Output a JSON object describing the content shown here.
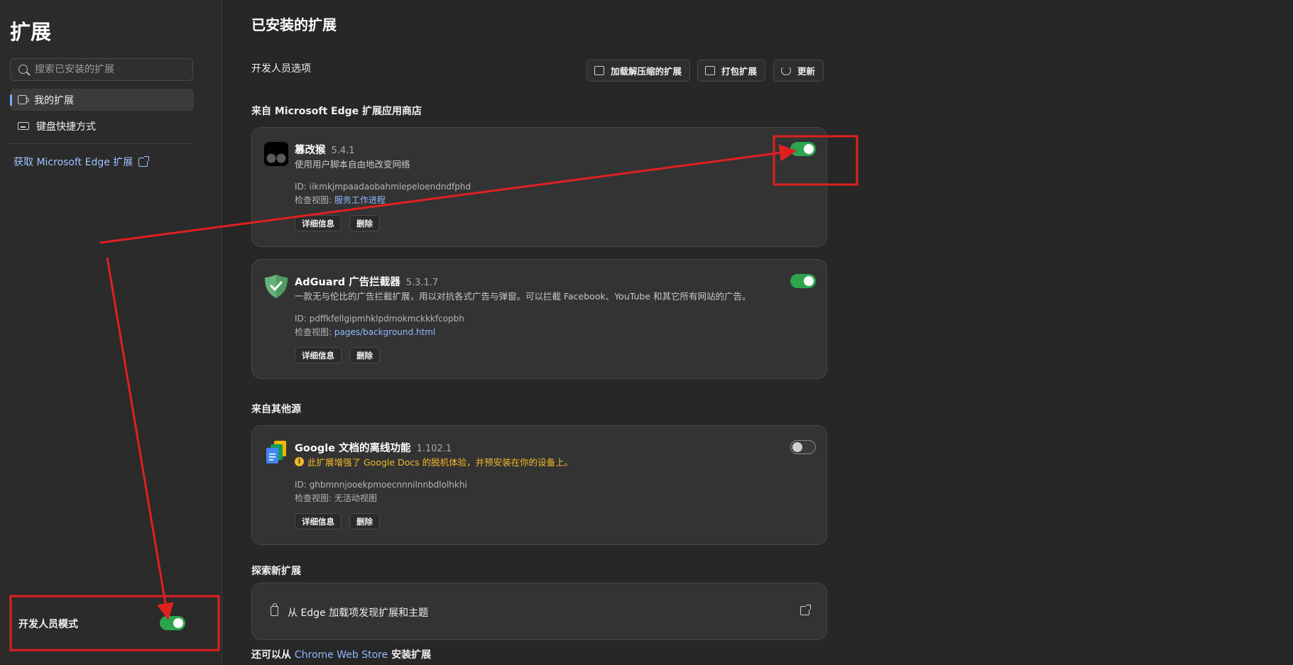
{
  "sidebar": {
    "title": "扩展",
    "search_placeholder": "搜索已安装的扩展",
    "nav": [
      {
        "label": "我的扩展",
        "icon": "puzzle-icon",
        "active": true
      },
      {
        "label": "键盘快捷方式",
        "icon": "keyboard-icon",
        "active": false
      }
    ],
    "get_extensions_label": "获取 Microsoft Edge 扩展",
    "developer_mode_label": "开发人员模式",
    "developer_mode_on": true
  },
  "main": {
    "title": "已安装的扩展",
    "developer_options_label": "开发人员选项",
    "toolbar": {
      "load_unpacked": "加载解压缩的扩展",
      "pack": "打包扩展",
      "update": "更新"
    },
    "store_section_label": "来自 Microsoft Edge 扩展应用商店",
    "other_section_label": "来自其他源",
    "explore_section_label": "探索新扩展",
    "explore_link_label": "从 Edge 加载项发现扩展和主题",
    "bottom_prefix": "还可以从",
    "bottom_link": "Chrome Web Store",
    "bottom_suffix": "安装扩展"
  },
  "extensions": [
    {
      "name": "篡改猴",
      "version": "5.4.1",
      "description": "使用用户脚本自由地改变网络",
      "id_label": "ID: iikmkjmpaadaobahmlepeloendndfphd",
      "inspect_prefix": "检查视图:",
      "inspect_link": "服务工作进程",
      "details": "详细信息",
      "remove": "删除",
      "enabled": true,
      "icon": "tampermonkey-icon"
    },
    {
      "name": "AdGuard 广告拦截器",
      "version": "5.3.1.7",
      "description": "一款无与伦比的广告拦截扩展，用以对抗各式广告与弹窗。可以拦截 Facebook、YouTube 和其它所有网站的广告。",
      "id_label": "ID: pdffkfellgipmhklpdmokmckkkfcopbh",
      "inspect_prefix": "检查视图:",
      "inspect_link": "pages/background.html",
      "details": "详细信息",
      "remove": "删除",
      "enabled": true,
      "icon": "adguard-shield-icon"
    },
    {
      "name": "Google 文档的离线功能",
      "version": "1.102.1",
      "warning": "此扩展增强了 Google Docs 的脱机体验，并预安装在你的设备上。",
      "id_label": "ID: ghbmnnjooekpmoecnnnilnnbdlolhkhi",
      "inspect_prefix": "检查视图:",
      "inspect_text": "无活动视图",
      "details": "详细信息",
      "remove": "删除",
      "enabled": false,
      "icon": "google-docs-icon"
    }
  ],
  "colors": {
    "toggle_on": "#2ea44f",
    "link": "#8fb8ff",
    "warning": "#f3b928",
    "annotation": "#e02020"
  }
}
